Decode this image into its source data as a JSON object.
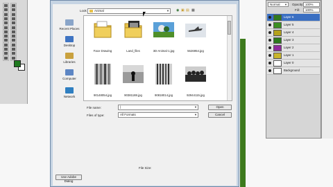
{
  "dialog": {
    "look_in_label": "Look in:",
    "look_in_value": "Animal",
    "file_name_label": "File name:",
    "file_name_value": "|",
    "files_of_type_label": "Files of type:",
    "files_of_type_value": "All Formats",
    "open_button": "Open",
    "cancel_button": "Cancel",
    "file_size_label": "File Size:",
    "adobe_dialog_button": "Use Adobe Dialog"
  },
  "places": [
    {
      "label": "Recent Places",
      "icon": "recent-places-icon",
      "color": "#8aa5c9"
    },
    {
      "label": "Desktop",
      "icon": "desktop-icon",
      "color": "#3f74c2"
    },
    {
      "label": "Libraries",
      "icon": "libraries-icon",
      "color": "#c9a13e"
    },
    {
      "label": "Computer",
      "icon": "computer-icon",
      "color": "#5d86c4"
    },
    {
      "label": "Network",
      "icon": "network-icon",
      "color": "#2f7fc1"
    }
  ],
  "files": [
    {
      "name": "Face Drawing",
      "kind": "folder"
    },
    {
      "name": "Land_files",
      "kind": "folder"
    },
    {
      "name": "3D-Animal-1.jpg",
      "kind": "image-bird"
    },
    {
      "name": "5626954.jpg",
      "kind": "image-plane"
    },
    {
      "name": "90148054.jpg",
      "kind": "image-bw-stripes"
    },
    {
      "name": "90381188.jpg",
      "kind": "image-bw-figure"
    },
    {
      "name": "90818014.jpg",
      "kind": "image-bw-columns"
    },
    {
      "name": "92944115.jpg",
      "kind": "image-bw-crowd"
    }
  ],
  "layers_panel": {
    "blend_mode": "Normal",
    "opacity_label": "Opacity:",
    "opacity_value": "100%",
    "fill_label": "Fill:",
    "fill_value": "100%",
    "layers": [
      {
        "name": "Layer 6",
        "selected": true,
        "thumb": "#2f7a1f"
      },
      {
        "name": "Layer 5",
        "selected": false,
        "thumb": "#3b8f22"
      },
      {
        "name": "Layer 4",
        "selected": false,
        "thumb": "#b5a21c"
      },
      {
        "name": "Layer 3",
        "selected": false,
        "thumb": "#2c7a1c"
      },
      {
        "name": "Layer 2",
        "selected": false,
        "thumb": "#8f2a9c"
      },
      {
        "name": "Layer 1",
        "selected": false,
        "thumb": "#c9b52b"
      },
      {
        "name": "Layer 0",
        "selected": false,
        "thumb": "#ffffff"
      },
      {
        "name": "Background",
        "selected": false,
        "thumb": "#ffffff"
      }
    ]
  },
  "colors": {
    "foreground": "#1f7a1f",
    "background": "#ffffff",
    "folder": "#e7c24a",
    "selection": "#3a6fc2"
  }
}
